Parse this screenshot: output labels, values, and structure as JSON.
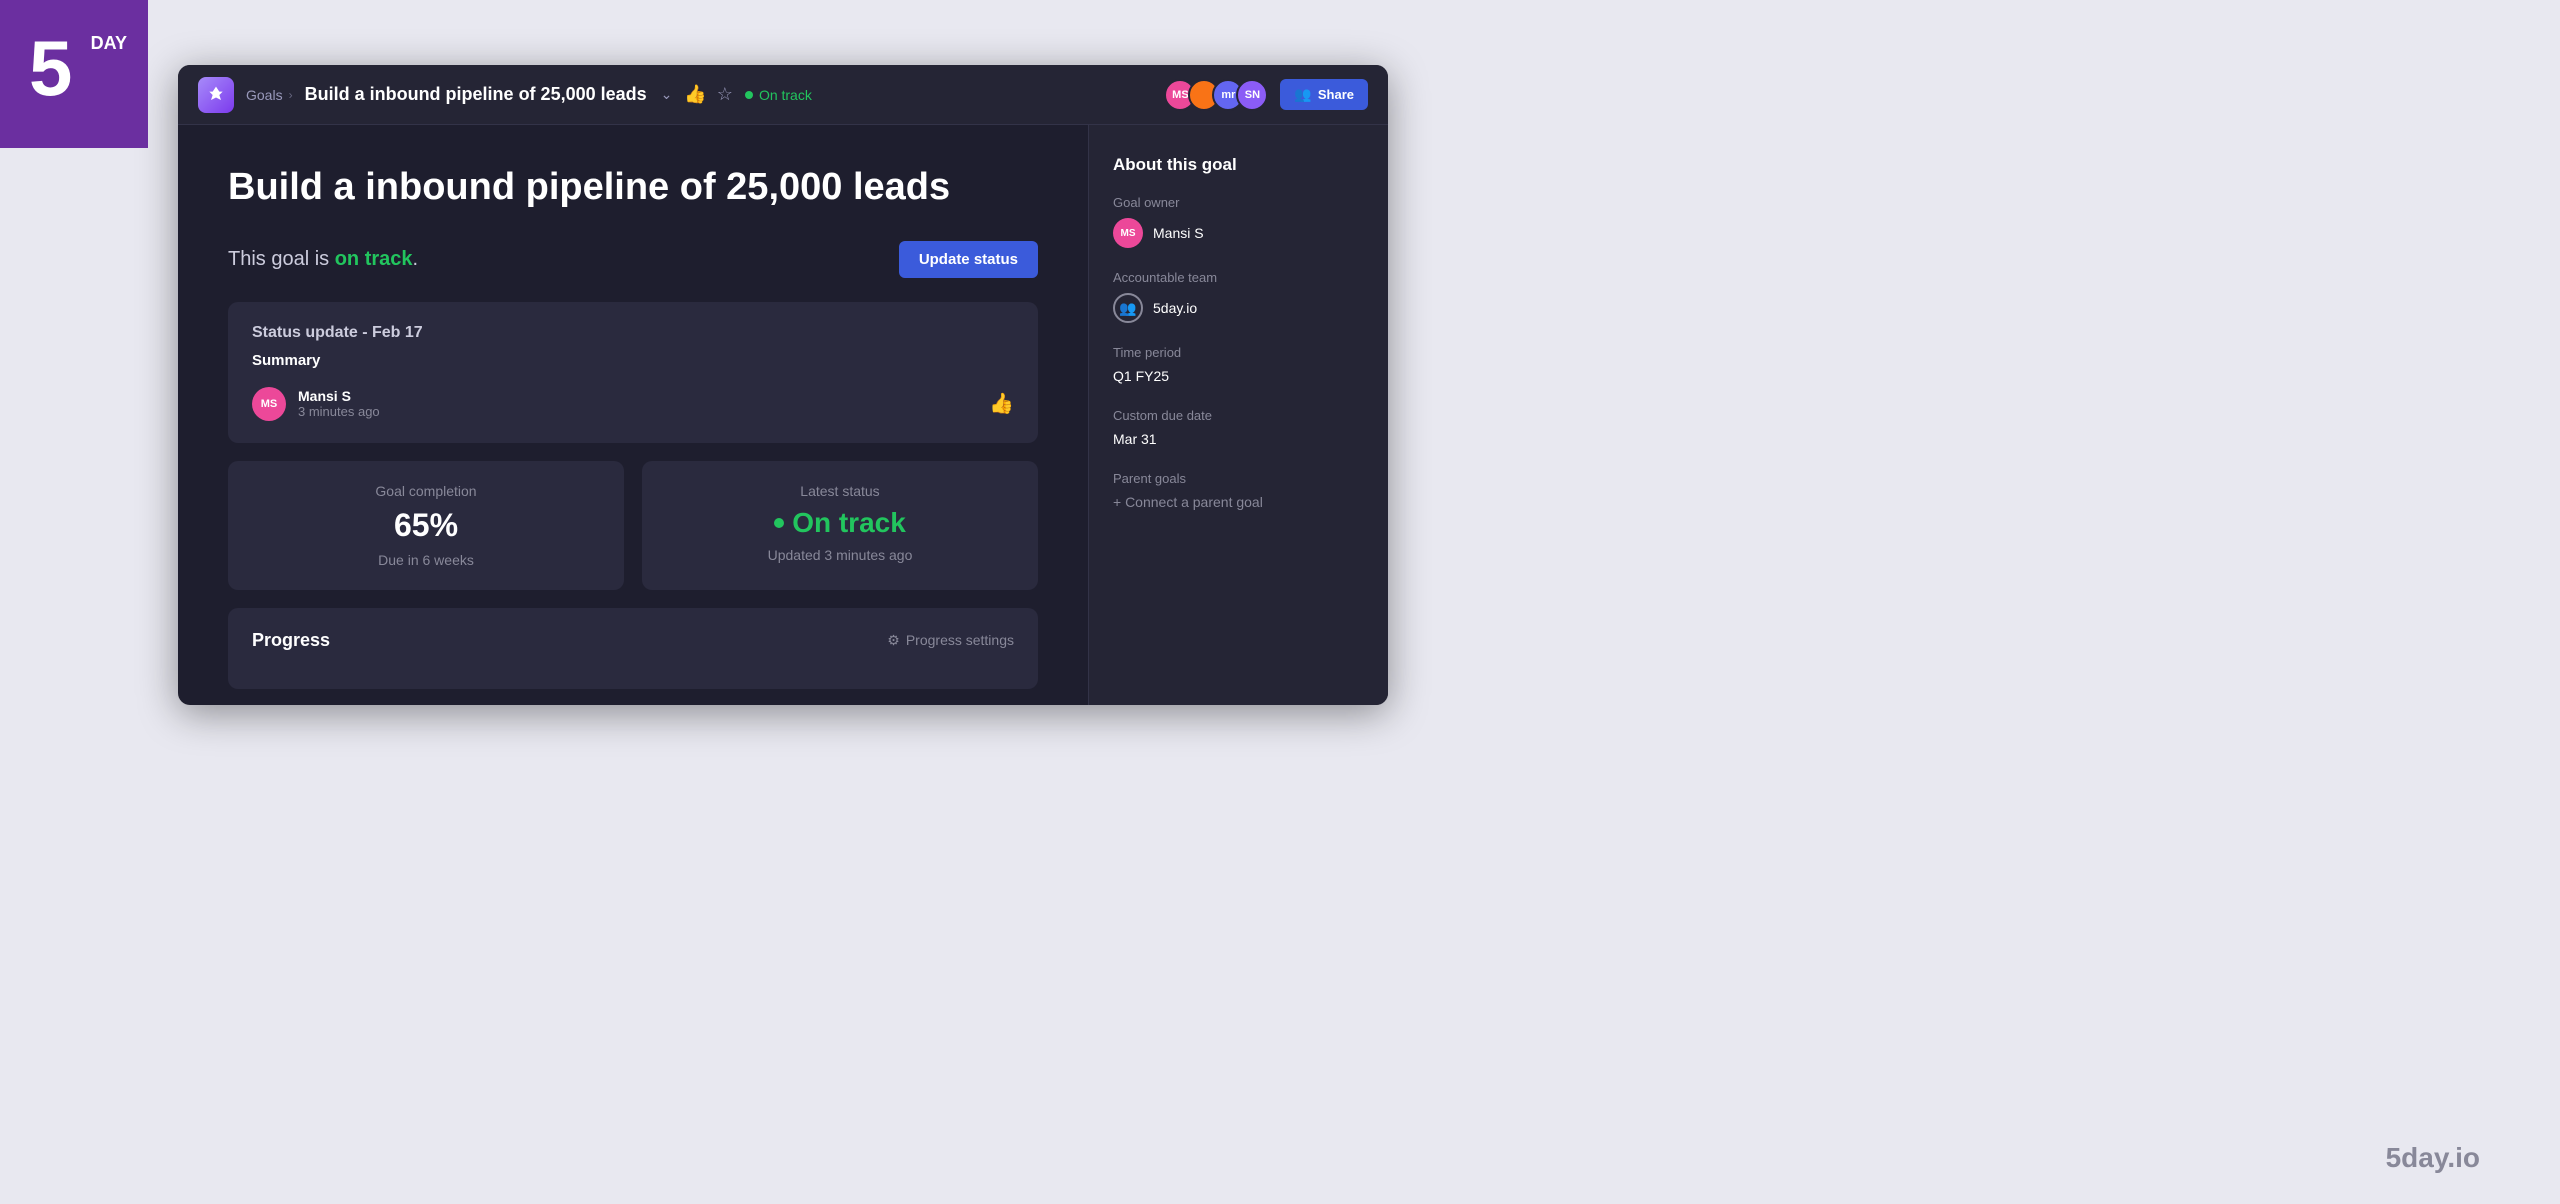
{
  "logo": {
    "number": "5",
    "word": "DAY",
    "watermark": "5day.io"
  },
  "header": {
    "breadcrumb_goals": "Goals",
    "title": "Build a inbound pipeline of 25,000 leads",
    "on_track_label": "On track",
    "share_label": "Share",
    "avatars": [
      {
        "initials": "MS",
        "color": "#ec4899"
      },
      {
        "initials": "",
        "color": "#f97316"
      },
      {
        "initials": "mr",
        "color": "#6366f1"
      },
      {
        "initials": "SN",
        "color": "#8b5cf6"
      }
    ]
  },
  "page": {
    "title": "Build a inbound pipeline of 25,000 leads",
    "status_prefix": "This goal is ",
    "status_value": "on track",
    "status_suffix": ".",
    "update_status_btn": "Update status"
  },
  "status_update": {
    "date": "Status update - Feb 17",
    "summary_label": "Summary",
    "author_initials": "MS",
    "author_name": "Mansi S",
    "author_time": "3 minutes ago"
  },
  "stats": {
    "completion": {
      "label": "Goal completion",
      "value": "65%",
      "sub": "Due in 6 weeks"
    },
    "latest_status": {
      "label": "Latest status",
      "value": "On track",
      "sub": "Updated 3 minutes ago"
    }
  },
  "progress": {
    "title": "Progress",
    "settings_label": "Progress settings"
  },
  "sidebar": {
    "section_title": "About this goal",
    "goal_owner_label": "Goal owner",
    "goal_owner_initials": "MS",
    "goal_owner_name": "Mansi S",
    "accountable_team_label": "Accountable team",
    "accountable_team_name": "5day.io",
    "time_period_label": "Time period",
    "time_period_value": "Q1 FY25",
    "custom_due_date_label": "Custom due date",
    "custom_due_date_value": "Mar 31",
    "parent_goals_label": "Parent goals",
    "connect_parent_label": "+ Connect a parent goal"
  }
}
